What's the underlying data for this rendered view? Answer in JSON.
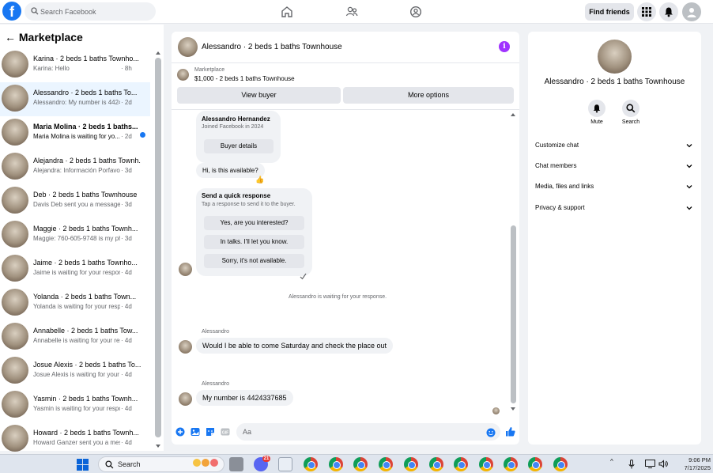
{
  "topbar": {
    "search_placeholder": "Search Facebook",
    "find_friends": "Find friends",
    "accent": "#1877f2"
  },
  "sidebar": {
    "title": "Marketplace",
    "conversations": [
      {
        "name": "Karina · 2 beds 1 baths Townho...",
        "preview": "Karina: Hello",
        "time": "· 8h"
      },
      {
        "name": "Alessandro · 2 beds 1 baths To...",
        "preview": "Alessandro: My number is 442433...",
        "time": "· 2d"
      },
      {
        "name": "Maria Molina · 2 beds 1 baths...",
        "preview": "Maria Molina is waiting for yo...",
        "time": "· 2d"
      },
      {
        "name": "Alejandra · 2 beds 1 baths Townh...",
        "preview": "Alejandra: Información Porfavor",
        "time": "· 3d"
      },
      {
        "name": "Deb · 2 beds 1 baths Townhouse",
        "preview": "Davis Deb sent you a message ab...",
        "time": "· 3d"
      },
      {
        "name": "Maggie · 2 beds 1 baths Townh...",
        "preview": "Maggie: 760-605-9748 is my pho...",
        "time": "· 3d"
      },
      {
        "name": "Jaime · 2 beds 1 baths Townho...",
        "preview": "Jaime is waiting for your response.",
        "time": "· 4d"
      },
      {
        "name": "Yolanda · 2 beds 1 baths Town...",
        "preview": "Yolanda is waiting for your respon...",
        "time": "· 4d"
      },
      {
        "name": "Annabelle · 2 beds 1 baths Tow...",
        "preview": "Annabelle is waiting for your resp...",
        "time": "· 4d"
      },
      {
        "name": "Josue Alexis · 2 beds 1 baths To...",
        "preview": "Josue Alexis is waiting for your re...",
        "time": "· 4d"
      },
      {
        "name": "Yasmin · 2 beds 1 baths Townh...",
        "preview": "Yasmin is waiting for your respo...",
        "time": "· 4d"
      },
      {
        "name": "Howard · 2 beds 1 baths Townh...",
        "preview": "Howard Ganzer sent you a messa...",
        "time": "· 4d"
      }
    ]
  },
  "chat": {
    "title": "Alessandro · 2 beds 1 baths Townhouse",
    "listing_source": "Marketplace",
    "listing_price": "$1,000 - 2 beds 1 baths Townhouse",
    "view_buyer": "View buyer",
    "more_options": "More options",
    "buyer_name": "Alessandro Hernandez",
    "buyer_joined": "Joined Facebook in 2024",
    "buyer_details": "Buyer details",
    "msg_available": "Hi, is this available?",
    "quick_title": "Send a quick response",
    "quick_sub": "Tap a response to send it to the buyer.",
    "quick_1": "Yes, are you interested?",
    "quick_2": "In talks. I'll let you know.",
    "quick_3": "Sorry, it's not available.",
    "waiting": "Alessandro is waiting for your response.",
    "sender_1": "Alessandro",
    "msg_saturday": "Would I be able to come Saturday and check the place out",
    "sender_2": "Alessandro",
    "msg_number": "My number is 4424337685",
    "composer_placeholder": "Aa"
  },
  "info": {
    "title": "Alessandro · 2 beds 1 baths Townhouse",
    "mute": "Mute",
    "search": "Search",
    "rows": [
      "Customize chat",
      "Chat members",
      "Media, files and links",
      "Privacy & support"
    ]
  },
  "taskbar": {
    "search_label": "Search",
    "time": "9:06 PM",
    "date": "7/17/2025",
    "discord_badge": "21"
  }
}
